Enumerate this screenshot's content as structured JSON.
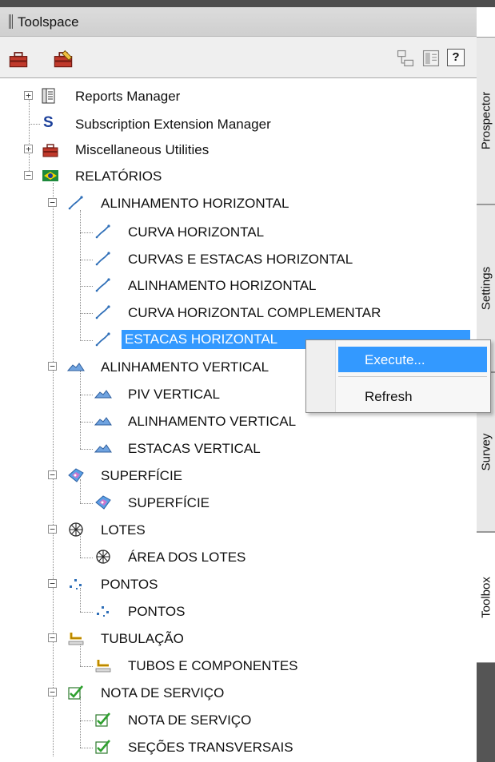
{
  "window": {
    "title": "Toolspace"
  },
  "toolbar": {
    "help_label": "?"
  },
  "tree": {
    "reports_manager": "Reports Manager",
    "subscription": "Subscription Extension Manager",
    "misc": "Miscellaneous Utilities",
    "relatorios": "RELATÓRIOS",
    "alinh_horizontal": "ALINHAMENTO HORIZONTAL",
    "curva_horizontal": "CURVA HORIZONTAL",
    "curvas_estacas": "CURVAS E ESTACAS HORIZONTAL",
    "alinh_horizontal_item": "ALINHAMENTO HORIZONTAL",
    "curva_complementar": "CURVA HORIZONTAL COMPLEMENTAR",
    "estacas_horizontal": "ESTACAS HORIZONTAL",
    "alinh_vertical": "ALINHAMENTO VERTICAL",
    "piv_vertical": "PIV VERTICAL",
    "alinh_vertical_item": "ALINHAMENTO VERTICAL",
    "estacas_vertical": "ESTACAS VERTICAL",
    "superficie": "SUPERFÍCIE",
    "superficie_item": "SUPERFÍCIE",
    "lotes": "LOTES",
    "area_lotes": "ÁREA DOS LOTES",
    "pontos": "PONTOS",
    "pontos_item": "PONTOS",
    "tubulacao": "TUBULAÇÃO",
    "tubos": "TUBOS E COMPONENTES",
    "nota_servico": "NOTA DE SERVIÇO",
    "nota_servico_item": "NOTA DE SERVIÇO",
    "secoes": "SEÇÕES TRANSVERSAIS",
    "expander_expanded": "−",
    "expander_collapsed": "+",
    "subscription_icon": "S"
  },
  "context_menu": {
    "execute": "Execute...",
    "refresh": "Refresh"
  },
  "side_tabs": {
    "prospector": "Prospector",
    "settings": "Settings",
    "survey": "Survey",
    "toolbox": "Toolbox"
  },
  "colors": {
    "selection": "#3399ff",
    "toolbox_red": "#c0392b",
    "flag_green": "#1e8a3c",
    "flag_yellow": "#f2d200",
    "flag_blue": "#1b3f9a"
  }
}
